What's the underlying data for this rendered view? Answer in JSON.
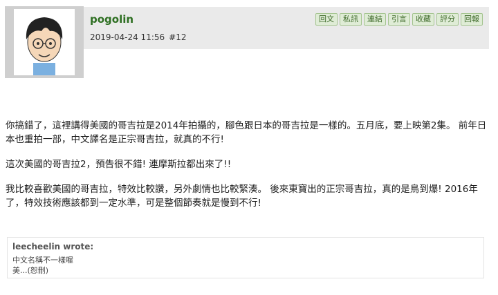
{
  "post": {
    "username": "pogolin",
    "datetime": "2019-04-24 11:56",
    "post_number": "#12",
    "actions": [
      "回文",
      "私訊",
      "連結",
      "引言",
      "收藏",
      "評分",
      "回報"
    ]
  },
  "body": {
    "paragraphs": [
      "你搞錯了，這裡講得美國的哥吉拉是2014年拍攝的，腳色跟日本的哥吉拉是一樣的。五月底，要上映第2集。 前年日本也重拍一部，中文譯名是正宗哥吉拉，就真的不行!",
      "這次美國的哥吉拉2，預告很不錯! 連摩斯拉都出來了!!",
      "我比較喜歡美國的哥吉拉，特效比較讚，另外劇情也比較緊湊。 後來東寶出的正宗哥吉拉，真的是鳥到爆! 2016年了，特效技術應該都到一定水準，可是整個節奏就是慢到不行!"
    ]
  },
  "quote": {
    "author": "leecheelin wrote:",
    "line1": "中文名稱不一樣喔",
    "line2": "美...(恕刪)"
  }
}
